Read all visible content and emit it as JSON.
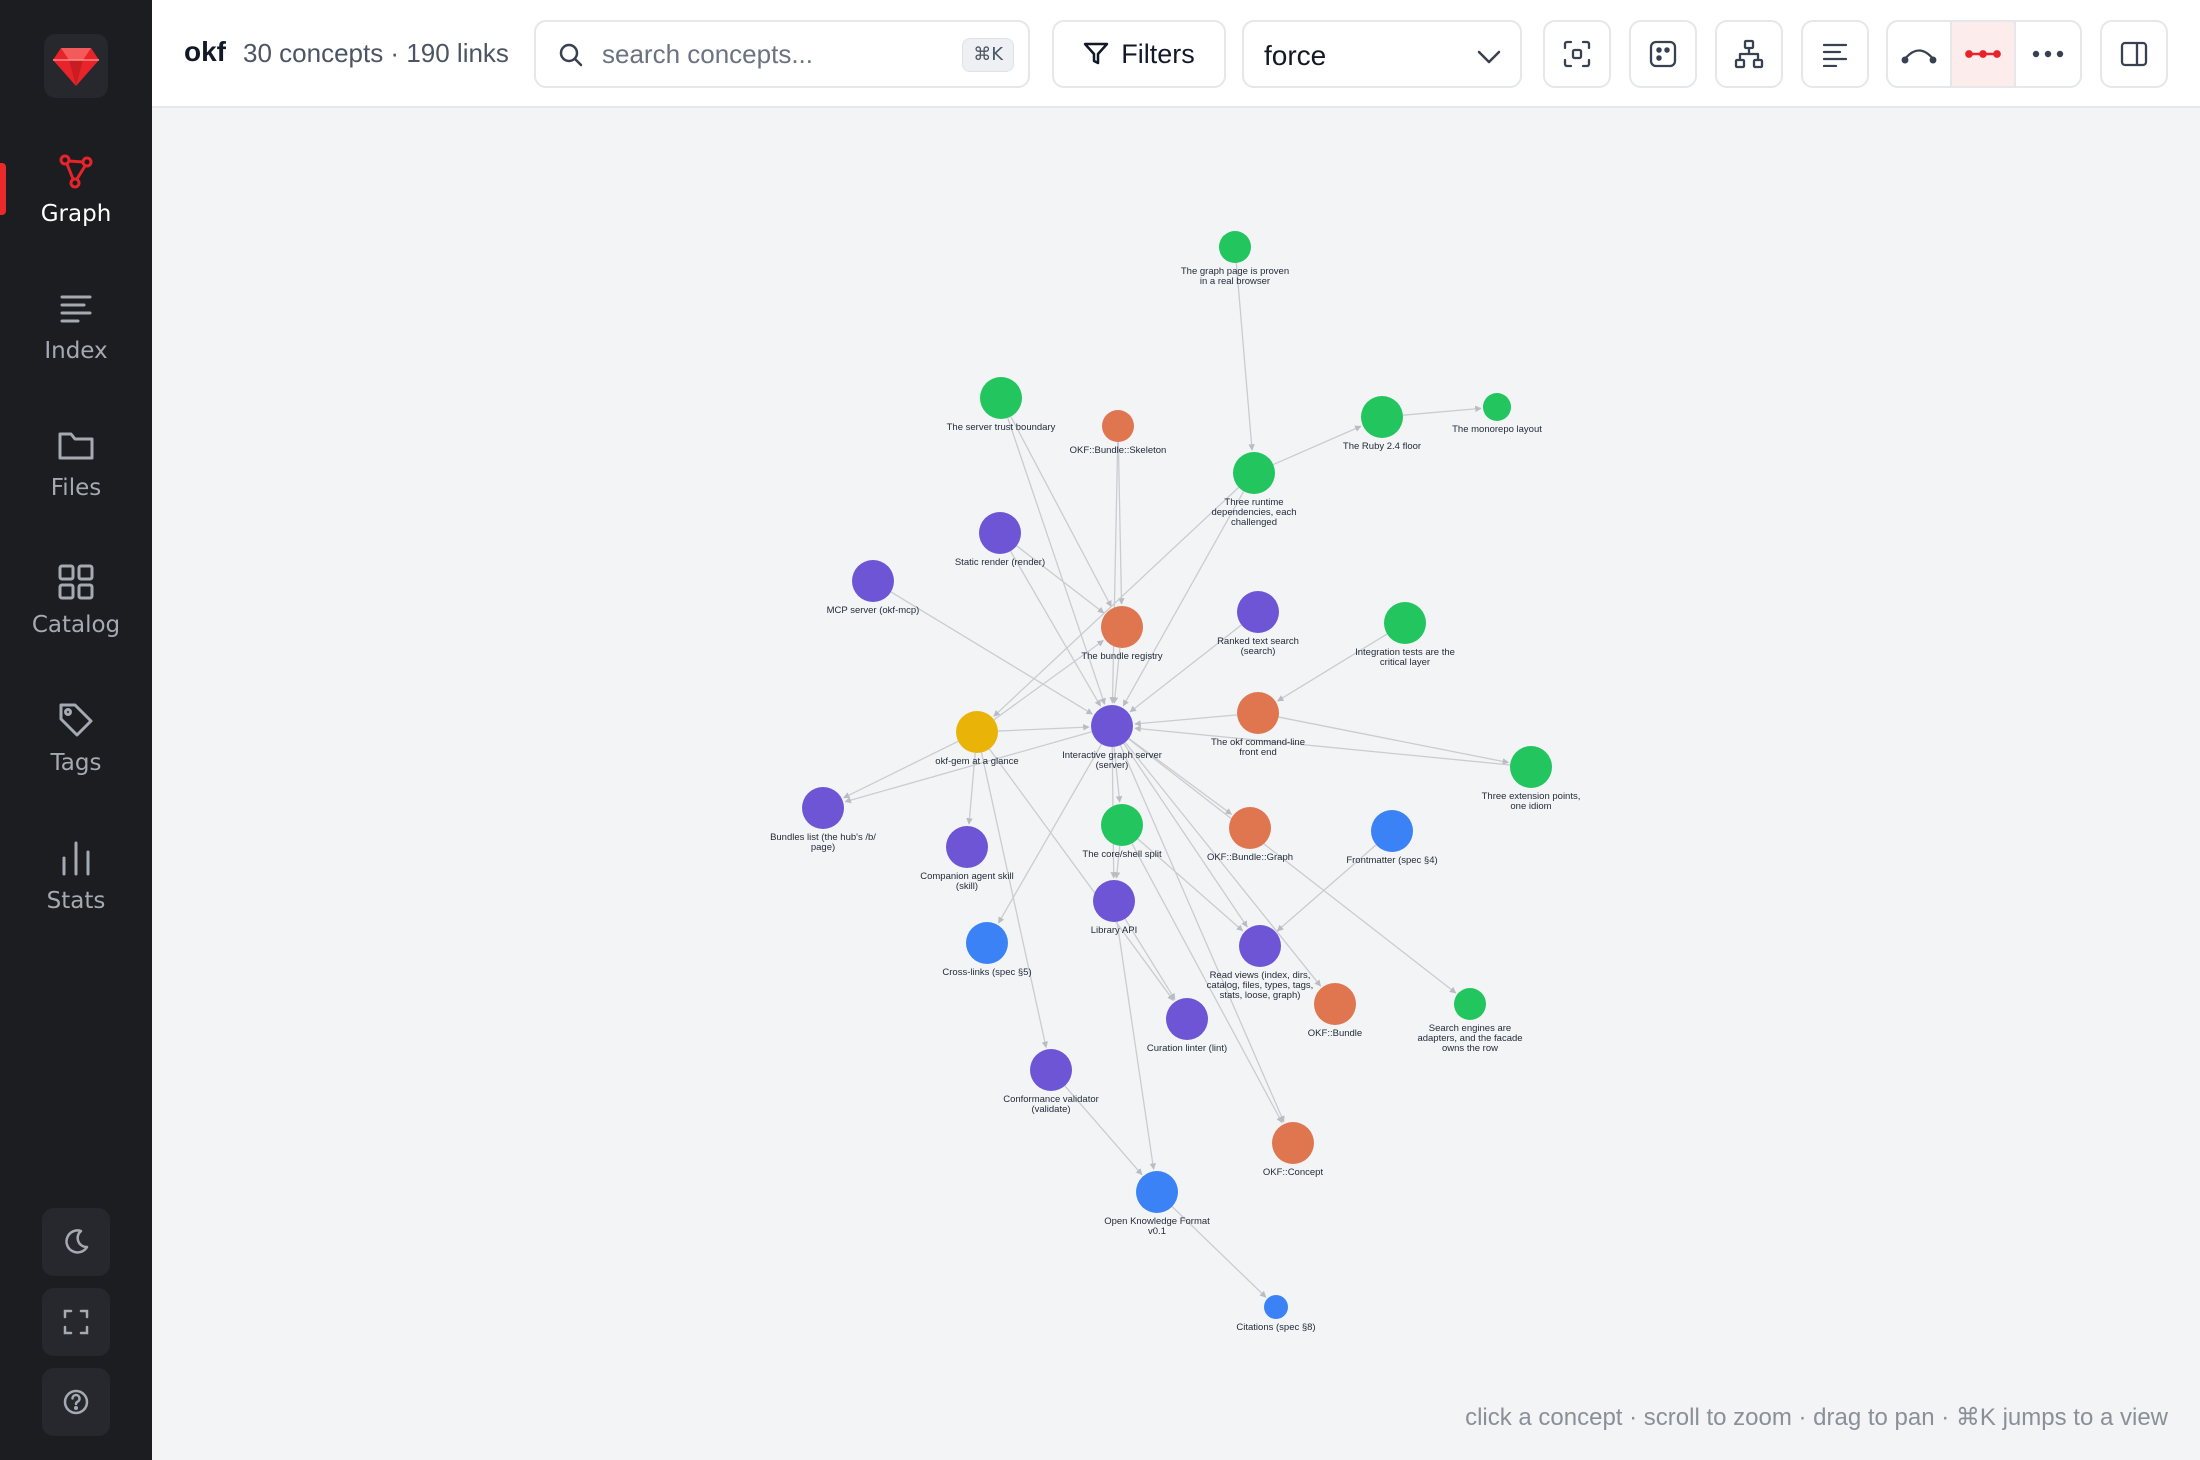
{
  "app": {
    "name": "okf",
    "stats": "30 concepts · 190 links"
  },
  "search": {
    "placeholder": "search concepts...",
    "shortcut": "⌘K"
  },
  "toolbar": {
    "filters_label": "Filters",
    "layout_value": "force"
  },
  "sidebar": {
    "items": [
      {
        "label": "Graph",
        "icon": "graph-icon",
        "active": true
      },
      {
        "label": "Index",
        "icon": "list-icon",
        "active": false
      },
      {
        "label": "Files",
        "icon": "folder-icon",
        "active": false
      },
      {
        "label": "Catalog",
        "icon": "grid-icon",
        "active": false
      },
      {
        "label": "Tags",
        "icon": "tag-icon",
        "active": false
      },
      {
        "label": "Stats",
        "icon": "bar-chart-icon",
        "active": false
      }
    ],
    "bottom": [
      "moon-icon",
      "fullscreen-icon",
      "help-icon"
    ]
  },
  "colors": {
    "accent": "#e8242a",
    "green": "#22c55e",
    "orange": "#e07650",
    "purple": "#6d55d6",
    "blue": "#3b82f6",
    "yellow": "#eab308",
    "edge": "#c9ccd1"
  },
  "graph": {
    "nodes": [
      {
        "id": "g1",
        "label": "The graph page is proven in a real browser",
        "color": "green"
      },
      {
        "id": "trust",
        "label": "The server trust boundary",
        "color": "green"
      },
      {
        "id": "skel",
        "label": "OKF::Bundle::Skeleton",
        "color": "orange"
      },
      {
        "id": "runtime",
        "label": "Three runtime dependencies, each challenged",
        "color": "green"
      },
      {
        "id": "ruby",
        "label": "The Ruby 2.4 floor",
        "color": "green"
      },
      {
        "id": "mono",
        "label": "The monorepo layout",
        "color": "green"
      },
      {
        "id": "static",
        "label": "Static render (render)",
        "color": "purple"
      },
      {
        "id": "mcp",
        "label": "MCP server (okf-mcp)",
        "color": "purple"
      },
      {
        "id": "registry",
        "label": "The bundle registry",
        "color": "orange"
      },
      {
        "id": "ranked",
        "label": "Ranked text search (search)",
        "color": "purple"
      },
      {
        "id": "integ",
        "label": "Integration tests are the critical layer",
        "color": "green"
      },
      {
        "id": "cli",
        "label": "The okf command-line front end",
        "color": "orange"
      },
      {
        "id": "glance",
        "label": "okf-gem at a glance",
        "color": "yellow"
      },
      {
        "id": "server",
        "label": "Interactive graph server (server)",
        "color": "purple"
      },
      {
        "id": "ext",
        "label": "Three extension points, one idiom",
        "color": "green"
      },
      {
        "id": "bundles",
        "label": "Bundles list (the hub's /b/ page)",
        "color": "purple"
      },
      {
        "id": "skill",
        "label": "Companion agent skill (skill)",
        "color": "purple"
      },
      {
        "id": "core",
        "label": "The core/shell split",
        "color": "green"
      },
      {
        "id": "bgraph",
        "label": "OKF::Bundle::Graph",
        "color": "orange"
      },
      {
        "id": "front",
        "label": "Frontmatter (spec §4)",
        "color": "blue"
      },
      {
        "id": "lib",
        "label": "Library API",
        "color": "purple"
      },
      {
        "id": "xlinks",
        "label": "Cross-links (spec §5)",
        "color": "blue"
      },
      {
        "id": "views",
        "label": "Read views (index, dirs, catalog, files, types, tags, stats, loose, graph)",
        "color": "purple"
      },
      {
        "id": "bundle",
        "label": "OKF::Bundle",
        "color": "orange"
      },
      {
        "id": "search",
        "label": "Search engines are adapters, and the facade owns the row",
        "color": "green"
      },
      {
        "id": "lint",
        "label": "Curation linter (lint)",
        "color": "purple"
      },
      {
        "id": "conform",
        "label": "Conformance validator (validate)",
        "color": "purple"
      },
      {
        "id": "concept",
        "label": "OKF::Concept",
        "color": "orange"
      },
      {
        "id": "okf",
        "label": "Open Knowledge Format v0.1",
        "color": "blue"
      },
      {
        "id": "cite",
        "label": "Citations (spec §8)",
        "color": "blue"
      }
    ],
    "edges": [
      [
        "g1",
        "runtime"
      ],
      [
        "trust",
        "server"
      ],
      [
        "trust",
        "registry"
      ],
      [
        "skel",
        "server"
      ],
      [
        "skel",
        "registry"
      ],
      [
        "runtime",
        "server"
      ],
      [
        "runtime",
        "ruby"
      ],
      [
        "ruby",
        "mono"
      ],
      [
        "runtime",
        "glance"
      ],
      [
        "static",
        "server"
      ],
      [
        "static",
        "registry"
      ],
      [
        "mcp",
        "server"
      ],
      [
        "registry",
        "server"
      ],
      [
        "ranked",
        "server"
      ],
      [
        "integ",
        "cli"
      ],
      [
        "cli",
        "server"
      ],
      [
        "cli",
        "ext"
      ],
      [
        "glance",
        "server"
      ],
      [
        "glance",
        "bundles"
      ],
      [
        "glance",
        "skill"
      ],
      [
        "glance",
        "conform"
      ],
      [
        "glance",
        "lint"
      ],
      [
        "server",
        "bundles"
      ],
      [
        "server",
        "core"
      ],
      [
        "server",
        "bgraph"
      ],
      [
        "server",
        "lib"
      ],
      [
        "server",
        "xlinks"
      ],
      [
        "server",
        "views"
      ],
      [
        "server",
        "concept"
      ],
      [
        "server",
        "search"
      ],
      [
        "server",
        "bundle"
      ],
      [
        "core",
        "lib"
      ],
      [
        "core",
        "views"
      ],
      [
        "core",
        "concept"
      ],
      [
        "front",
        "views"
      ],
      [
        "lib",
        "lint"
      ],
      [
        "lib",
        "okf"
      ],
      [
        "okf",
        "cite"
      ],
      [
        "conform",
        "okf"
      ],
      [
        "ext",
        "server"
      ],
      [
        "glance",
        "registry"
      ]
    ]
  },
  "hint": "click a concept · scroll to zoom · drag to pan · ⌘K jumps to a view"
}
